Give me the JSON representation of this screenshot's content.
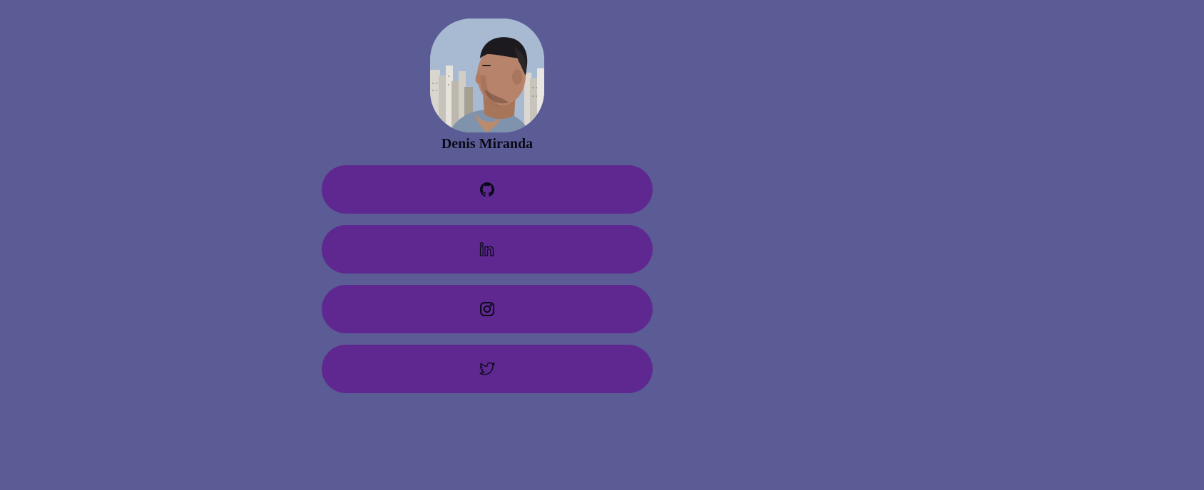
{
  "profile": {
    "name": "Denis Miranda"
  },
  "links": [
    {
      "icon": "github-icon"
    },
    {
      "icon": "linkedin-icon"
    },
    {
      "icon": "instagram-icon"
    },
    {
      "icon": "twitter-icon"
    }
  ],
  "colors": {
    "background": "#5b5b95",
    "button": "#5f2890",
    "text": "#0a0a18"
  }
}
